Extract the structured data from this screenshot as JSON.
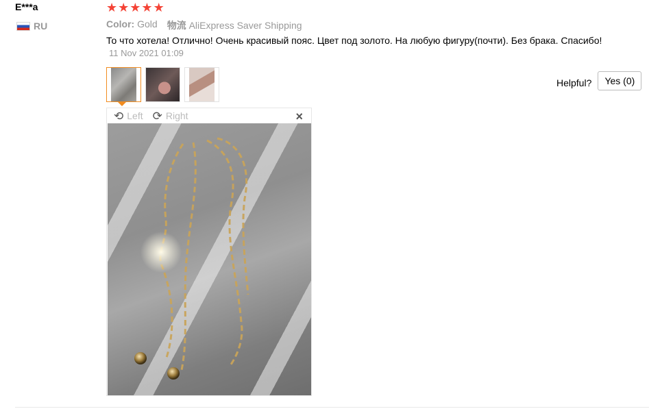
{
  "reviewer": {
    "name": "E***a",
    "country_code": "RU",
    "flag_icon": "russia-flag-icon"
  },
  "review": {
    "stars": [
      "★",
      "★",
      "★",
      "★",
      "★"
    ],
    "star_color": "#f44336",
    "color_label": "Color:",
    "color_value": "Gold",
    "shipping_label": "物流",
    "shipping_value": "AliExpress Saver Shipping",
    "text": "То что хотела! Отлично! Очень красивый пояс. Цвет под золото. На любую фигуру(почти). Без брака. Спасибо!",
    "date": "11 Nov 2021 01:09"
  },
  "helpful": {
    "label": "Helpful?",
    "yes_label": "Yes (0)"
  },
  "viewer": {
    "rotate_left_label": "Left",
    "rotate_right_label": "Right",
    "close_glyph": "×",
    "rotate_left_glyph": "⟲",
    "rotate_right_glyph": "⟳"
  },
  "accent_color": "#f18c20"
}
